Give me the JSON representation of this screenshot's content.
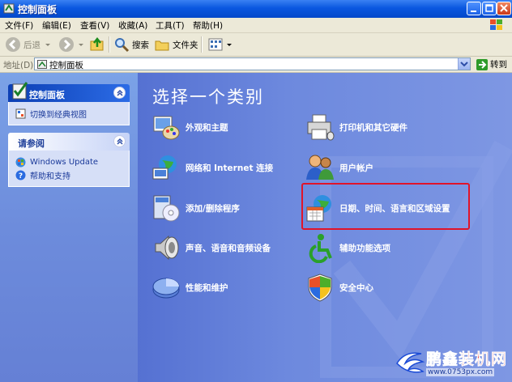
{
  "window": {
    "title": "控制面板"
  },
  "menu": [
    "文件(F)",
    "编辑(E)",
    "查看(V)",
    "收藏(A)",
    "工具(T)",
    "帮助(H)"
  ],
  "toolbar": {
    "back": "后退",
    "search": "搜索",
    "folders": "文件夹"
  },
  "address": {
    "label": "地址(D)",
    "value": "控制面板",
    "go": "转到"
  },
  "sidebar": {
    "panel_title": "控制面板",
    "switch_view": "切换到经典视图",
    "see_also_title": "请参阅",
    "see_also": [
      "Windows Update",
      "帮助和支持"
    ]
  },
  "main": {
    "heading": "选择一个类别",
    "categories_left": [
      {
        "label": "外观和主题",
        "icon": "appearance-icon"
      },
      {
        "label": "网络和 Internet 连接",
        "icon": "network-icon"
      },
      {
        "label": "添加/删除程序",
        "icon": "add-remove-icon"
      },
      {
        "label": "声音、语音和音频设备",
        "icon": "sound-icon"
      },
      {
        "label": "性能和维护",
        "icon": "performance-icon"
      }
    ],
    "categories_right": [
      {
        "label": "打印机和其它硬件",
        "icon": "printer-icon"
      },
      {
        "label": "用户帐户",
        "icon": "users-icon"
      },
      {
        "label": "日期、时间、语言和区域设置",
        "icon": "date-time-icon"
      },
      {
        "label": "辅助功能选项",
        "icon": "accessibility-icon"
      },
      {
        "label": "安全中心",
        "icon": "security-shield-icon"
      }
    ]
  },
  "watermark": {
    "brand_blue": "鹏鑫",
    "brand_red": "装机网",
    "url": "www.0753px.com"
  },
  "colors": {
    "highlight": "#e0142a",
    "main_bg": "#6d89de",
    "titlebar": "#0a57e0"
  }
}
